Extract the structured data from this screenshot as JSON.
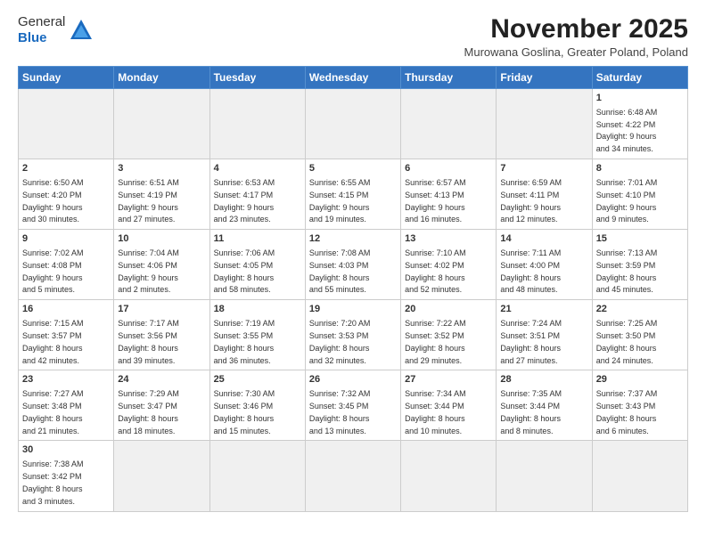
{
  "header": {
    "logo_general": "General",
    "logo_blue": "Blue",
    "month_year": "November 2025",
    "location": "Murowana Goslina, Greater Poland, Poland"
  },
  "weekdays": [
    "Sunday",
    "Monday",
    "Tuesday",
    "Wednesday",
    "Thursday",
    "Friday",
    "Saturday"
  ],
  "weeks": [
    [
      {
        "day": "",
        "info": ""
      },
      {
        "day": "",
        "info": ""
      },
      {
        "day": "",
        "info": ""
      },
      {
        "day": "",
        "info": ""
      },
      {
        "day": "",
        "info": ""
      },
      {
        "day": "",
        "info": ""
      },
      {
        "day": "1",
        "info": "Sunrise: 6:48 AM\nSunset: 4:22 PM\nDaylight: 9 hours\nand 34 minutes."
      }
    ],
    [
      {
        "day": "2",
        "info": "Sunrise: 6:50 AM\nSunset: 4:20 PM\nDaylight: 9 hours\nand 30 minutes."
      },
      {
        "day": "3",
        "info": "Sunrise: 6:51 AM\nSunset: 4:19 PM\nDaylight: 9 hours\nand 27 minutes."
      },
      {
        "day": "4",
        "info": "Sunrise: 6:53 AM\nSunset: 4:17 PM\nDaylight: 9 hours\nand 23 minutes."
      },
      {
        "day": "5",
        "info": "Sunrise: 6:55 AM\nSunset: 4:15 PM\nDaylight: 9 hours\nand 19 minutes."
      },
      {
        "day": "6",
        "info": "Sunrise: 6:57 AM\nSunset: 4:13 PM\nDaylight: 9 hours\nand 16 minutes."
      },
      {
        "day": "7",
        "info": "Sunrise: 6:59 AM\nSunset: 4:11 PM\nDaylight: 9 hours\nand 12 minutes."
      },
      {
        "day": "8",
        "info": "Sunrise: 7:01 AM\nSunset: 4:10 PM\nDaylight: 9 hours\nand 9 minutes."
      }
    ],
    [
      {
        "day": "9",
        "info": "Sunrise: 7:02 AM\nSunset: 4:08 PM\nDaylight: 9 hours\nand 5 minutes."
      },
      {
        "day": "10",
        "info": "Sunrise: 7:04 AM\nSunset: 4:06 PM\nDaylight: 9 hours\nand 2 minutes."
      },
      {
        "day": "11",
        "info": "Sunrise: 7:06 AM\nSunset: 4:05 PM\nDaylight: 8 hours\nand 58 minutes."
      },
      {
        "day": "12",
        "info": "Sunrise: 7:08 AM\nSunset: 4:03 PM\nDaylight: 8 hours\nand 55 minutes."
      },
      {
        "day": "13",
        "info": "Sunrise: 7:10 AM\nSunset: 4:02 PM\nDaylight: 8 hours\nand 52 minutes."
      },
      {
        "day": "14",
        "info": "Sunrise: 7:11 AM\nSunset: 4:00 PM\nDaylight: 8 hours\nand 48 minutes."
      },
      {
        "day": "15",
        "info": "Sunrise: 7:13 AM\nSunset: 3:59 PM\nDaylight: 8 hours\nand 45 minutes."
      }
    ],
    [
      {
        "day": "16",
        "info": "Sunrise: 7:15 AM\nSunset: 3:57 PM\nDaylight: 8 hours\nand 42 minutes."
      },
      {
        "day": "17",
        "info": "Sunrise: 7:17 AM\nSunset: 3:56 PM\nDaylight: 8 hours\nand 39 minutes."
      },
      {
        "day": "18",
        "info": "Sunrise: 7:19 AM\nSunset: 3:55 PM\nDaylight: 8 hours\nand 36 minutes."
      },
      {
        "day": "19",
        "info": "Sunrise: 7:20 AM\nSunset: 3:53 PM\nDaylight: 8 hours\nand 32 minutes."
      },
      {
        "day": "20",
        "info": "Sunrise: 7:22 AM\nSunset: 3:52 PM\nDaylight: 8 hours\nand 29 minutes."
      },
      {
        "day": "21",
        "info": "Sunrise: 7:24 AM\nSunset: 3:51 PM\nDaylight: 8 hours\nand 27 minutes."
      },
      {
        "day": "22",
        "info": "Sunrise: 7:25 AM\nSunset: 3:50 PM\nDaylight: 8 hours\nand 24 minutes."
      }
    ],
    [
      {
        "day": "23",
        "info": "Sunrise: 7:27 AM\nSunset: 3:48 PM\nDaylight: 8 hours\nand 21 minutes."
      },
      {
        "day": "24",
        "info": "Sunrise: 7:29 AM\nSunset: 3:47 PM\nDaylight: 8 hours\nand 18 minutes."
      },
      {
        "day": "25",
        "info": "Sunrise: 7:30 AM\nSunset: 3:46 PM\nDaylight: 8 hours\nand 15 minutes."
      },
      {
        "day": "26",
        "info": "Sunrise: 7:32 AM\nSunset: 3:45 PM\nDaylight: 8 hours\nand 13 minutes."
      },
      {
        "day": "27",
        "info": "Sunrise: 7:34 AM\nSunset: 3:44 PM\nDaylight: 8 hours\nand 10 minutes."
      },
      {
        "day": "28",
        "info": "Sunrise: 7:35 AM\nSunset: 3:44 PM\nDaylight: 8 hours\nand 8 minutes."
      },
      {
        "day": "29",
        "info": "Sunrise: 7:37 AM\nSunset: 3:43 PM\nDaylight: 8 hours\nand 6 minutes."
      }
    ],
    [
      {
        "day": "30",
        "info": "Sunrise: 7:38 AM\nSunset: 3:42 PM\nDaylight: 8 hours\nand 3 minutes."
      },
      {
        "day": "",
        "info": ""
      },
      {
        "day": "",
        "info": ""
      },
      {
        "day": "",
        "info": ""
      },
      {
        "day": "",
        "info": ""
      },
      {
        "day": "",
        "info": ""
      },
      {
        "day": "",
        "info": ""
      }
    ]
  ]
}
